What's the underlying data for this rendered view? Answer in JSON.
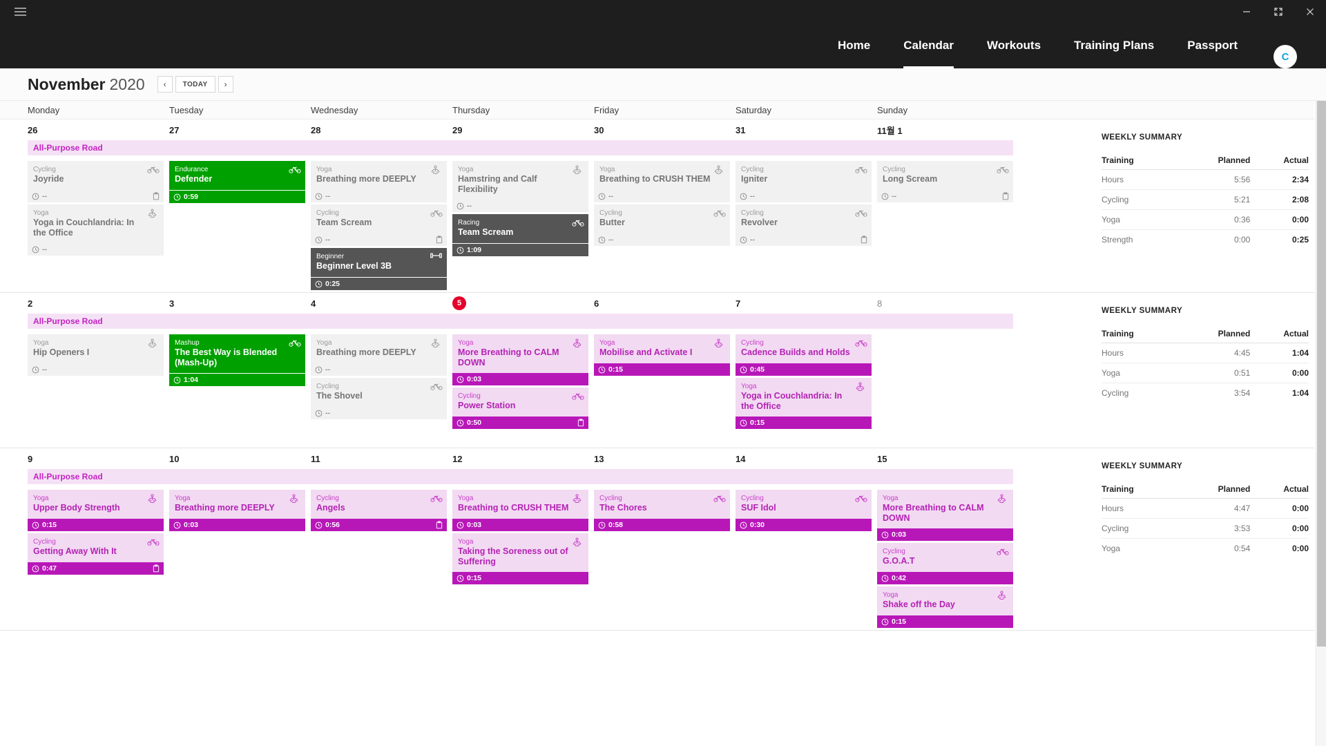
{
  "window": {
    "menu_icon": "hamburger-icon",
    "minimize_label": "minimize-icon",
    "maximize_label": "maximize-icon",
    "close_label": "close-icon"
  },
  "nav": {
    "items": [
      {
        "label": "Home",
        "active": false
      },
      {
        "label": "Calendar",
        "active": true
      },
      {
        "label": "Workouts",
        "active": false
      },
      {
        "label": "Training Plans",
        "active": false
      },
      {
        "label": "Passport",
        "active": false
      }
    ],
    "avatar_initial": "C"
  },
  "month_bar": {
    "month": "November",
    "year": "2020",
    "prev_label": "‹",
    "today_label": "TODAY",
    "next_label": "›"
  },
  "day_headers": [
    "Monday",
    "Tuesday",
    "Wednesday",
    "Thursday",
    "Friday",
    "Saturday",
    "Sunday"
  ],
  "colors": {
    "planned": "#b817b8",
    "planned_bg": "#f2daf2",
    "completed": "#00a000",
    "race": "#555555",
    "unplanned_bg": "#f1f1f1",
    "plan_band_bg": "#f5e1f5",
    "plan_band_text": "#c322c3",
    "today_badge": "#e4002b",
    "nav_bg": "#1e1e1e",
    "avatar_text": "#1a9fe0"
  },
  "weeks": [
    {
      "plan_band": {
        "label": "All-Purpose Road",
        "span_days": 7
      },
      "days": [
        {
          "num": "26",
          "today": false,
          "cards": [
            {
              "variant": "grey",
              "sport": "Cycling",
              "title": "Joyride",
              "icon": "bike-icon",
              "duration": "--",
              "note": true
            },
            {
              "variant": "grey",
              "sport": "Yoga",
              "title": "Yoga in Couchlandria: In the Office",
              "icon": "yoga-icon",
              "duration": "--",
              "note": false
            }
          ]
        },
        {
          "num": "27",
          "today": false,
          "cards": [
            {
              "variant": "green",
              "sport": "Endurance",
              "title": "Defender",
              "icon": "bike-icon",
              "duration": "0:59",
              "note": false
            }
          ]
        },
        {
          "num": "28",
          "today": false,
          "cards": [
            {
              "variant": "grey",
              "sport": "Yoga",
              "title": "Breathing more DEEPLY",
              "icon": "yoga-icon",
              "duration": "--",
              "note": false
            },
            {
              "variant": "grey",
              "sport": "Cycling",
              "title": "Team Scream",
              "icon": "bike-icon",
              "duration": "--",
              "note": true
            },
            {
              "variant": "dark",
              "sport": "Beginner",
              "title": "Beginner Level 3B",
              "icon": "dumbbell-icon",
              "duration": "0:25",
              "note": false
            }
          ]
        },
        {
          "num": "29",
          "today": false,
          "cards": [
            {
              "variant": "grey",
              "sport": "Yoga",
              "title": "Hamstring and Calf Flexibility",
              "icon": "yoga-icon",
              "duration": "--",
              "note": false
            },
            {
              "variant": "dark",
              "sport": "Racing",
              "title": "Team Scream",
              "icon": "bike-icon",
              "duration": "1:09",
              "note": false
            }
          ]
        },
        {
          "num": "30",
          "today": false,
          "cards": [
            {
              "variant": "grey",
              "sport": "Yoga",
              "title": "Breathing to CRUSH THEM",
              "icon": "yoga-icon",
              "duration": "--",
              "note": false
            },
            {
              "variant": "grey",
              "sport": "Cycling",
              "title": "Butter",
              "icon": "bike-icon",
              "duration": "--",
              "note": false
            }
          ]
        },
        {
          "num": "31",
          "today": false,
          "cards": [
            {
              "variant": "grey",
              "sport": "Cycling",
              "title": "Igniter",
              "icon": "bike-icon",
              "duration": "--",
              "note": false
            },
            {
              "variant": "grey",
              "sport": "Cycling",
              "title": "Revolver",
              "icon": "bike-icon",
              "duration": "--",
              "note": true
            }
          ]
        },
        {
          "num": "11월 1",
          "today": false,
          "cards": [
            {
              "variant": "grey",
              "sport": "Cycling",
              "title": "Long Scream",
              "icon": "bike-icon",
              "duration": "--",
              "note": true
            }
          ]
        }
      ],
      "summary": {
        "title": "WEEKLY SUMMARY",
        "headers": [
          "Training",
          "Planned",
          "Actual"
        ],
        "rows": [
          {
            "label": "Hours",
            "planned": "5:56",
            "actual": "2:34"
          },
          {
            "label": "Cycling",
            "planned": "5:21",
            "actual": "2:08"
          },
          {
            "label": "Yoga",
            "planned": "0:36",
            "actual": "0:00"
          },
          {
            "label": "Strength",
            "planned": "0:00",
            "actual": "0:25"
          }
        ]
      }
    },
    {
      "plan_band": {
        "label": "All-Purpose Road",
        "span_days": 7
      },
      "days": [
        {
          "num": "2",
          "today": false,
          "cards": [
            {
              "variant": "grey",
              "sport": "Yoga",
              "title": "Hip Openers I",
              "icon": "yoga-icon",
              "duration": "--",
              "note": false
            }
          ]
        },
        {
          "num": "3",
          "today": false,
          "cards": [
            {
              "variant": "green",
              "sport": "Mashup",
              "title": "The Best Way is Blended (Mash-Up)",
              "icon": "bike-icon",
              "duration": "1:04",
              "note": false
            }
          ]
        },
        {
          "num": "4",
          "today": false,
          "cards": [
            {
              "variant": "grey",
              "sport": "Yoga",
              "title": "Breathing more DEEPLY",
              "icon": "yoga-icon",
              "duration": "--",
              "note": false
            },
            {
              "variant": "grey",
              "sport": "Cycling",
              "title": "The Shovel",
              "icon": "bike-icon",
              "duration": "--",
              "note": false
            }
          ]
        },
        {
          "num": "5",
          "today": true,
          "cards": [
            {
              "variant": "purple",
              "sport": "Yoga",
              "title": "More Breathing to CALM DOWN",
              "icon": "yoga-icon",
              "duration": "0:03",
              "note": false
            },
            {
              "variant": "purple",
              "sport": "Cycling",
              "title": "Power Station",
              "icon": "bike-icon",
              "duration": "0:50",
              "note": true
            }
          ]
        },
        {
          "num": "6",
          "today": false,
          "cards": [
            {
              "variant": "purple",
              "sport": "Yoga",
              "title": "Mobilise and Activate I",
              "icon": "yoga-icon",
              "duration": "0:15",
              "note": false
            }
          ]
        },
        {
          "num": "7",
          "today": false,
          "cards": [
            {
              "variant": "purple",
              "sport": "Cycling",
              "title": "Cadence Builds and Holds",
              "icon": "bike-icon",
              "duration": "0:45",
              "note": false
            },
            {
              "variant": "purple",
              "sport": "Yoga",
              "title": "Yoga in Couchlandria: In the Office",
              "icon": "yoga-icon",
              "duration": "0:15",
              "note": false
            }
          ]
        },
        {
          "num": "8",
          "today": false,
          "muted": true,
          "cards": []
        }
      ],
      "summary": {
        "title": "WEEKLY SUMMARY",
        "headers": [
          "Training",
          "Planned",
          "Actual"
        ],
        "rows": [
          {
            "label": "Hours",
            "planned": "4:45",
            "actual": "1:04"
          },
          {
            "label": "Yoga",
            "planned": "0:51",
            "actual": "0:00"
          },
          {
            "label": "Cycling",
            "planned": "3:54",
            "actual": "1:04"
          }
        ]
      }
    },
    {
      "plan_band": {
        "label": "All-Purpose Road",
        "span_days": 7
      },
      "days": [
        {
          "num": "9",
          "today": false,
          "cards": [
            {
              "variant": "purple",
              "sport": "Yoga",
              "title": "Upper Body Strength",
              "icon": "yoga-icon",
              "duration": "0:15",
              "note": false
            },
            {
              "variant": "purple",
              "sport": "Cycling",
              "title": "Getting Away With It",
              "icon": "bike-icon",
              "duration": "0:47",
              "note": true
            }
          ]
        },
        {
          "num": "10",
          "today": false,
          "cards": [
            {
              "variant": "purple",
              "sport": "Yoga",
              "title": "Breathing more DEEPLY",
              "icon": "yoga-icon",
              "duration": "0:03",
              "note": false
            }
          ]
        },
        {
          "num": "11",
          "today": false,
          "cards": [
            {
              "variant": "purple",
              "sport": "Cycling",
              "title": "Angels",
              "icon": "bike-icon",
              "duration": "0:56",
              "note": true
            }
          ]
        },
        {
          "num": "12",
          "today": false,
          "cards": [
            {
              "variant": "purple",
              "sport": "Yoga",
              "title": "Breathing to CRUSH THEM",
              "icon": "yoga-icon",
              "duration": "0:03",
              "note": false
            },
            {
              "variant": "purple",
              "sport": "Yoga",
              "title": "Taking the Soreness out of Suffering",
              "icon": "yoga-icon",
              "duration": "0:15",
              "note": false
            }
          ]
        },
        {
          "num": "13",
          "today": false,
          "cards": [
            {
              "variant": "purple",
              "sport": "Cycling",
              "title": "The Chores",
              "icon": "bike-icon",
              "duration": "0:58",
              "note": false
            }
          ]
        },
        {
          "num": "14",
          "today": false,
          "cards": [
            {
              "variant": "purple",
              "sport": "Cycling",
              "title": "SUF Idol",
              "icon": "bike-icon",
              "duration": "0:30",
              "note": false
            }
          ]
        },
        {
          "num": "15",
          "today": false,
          "cards": [
            {
              "variant": "purple",
              "sport": "Yoga",
              "title": "More Breathing to CALM DOWN",
              "icon": "yoga-icon",
              "duration": "0:03",
              "note": false
            },
            {
              "variant": "purple",
              "sport": "Cycling",
              "title": "G.O.A.T",
              "icon": "bike-icon",
              "duration": "0:42",
              "note": false
            },
            {
              "variant": "purple",
              "sport": "Yoga",
              "title": "Shake off the Day",
              "icon": "yoga-icon",
              "duration": "0:15",
              "note": false
            }
          ]
        }
      ],
      "summary": {
        "title": "WEEKLY SUMMARY",
        "headers": [
          "Training",
          "Planned",
          "Actual"
        ],
        "rows": [
          {
            "label": "Hours",
            "planned": "4:47",
            "actual": "0:00"
          },
          {
            "label": "Cycling",
            "planned": "3:53",
            "actual": "0:00"
          },
          {
            "label": "Yoga",
            "planned": "0:54",
            "actual": "0:00"
          }
        ]
      }
    }
  ]
}
